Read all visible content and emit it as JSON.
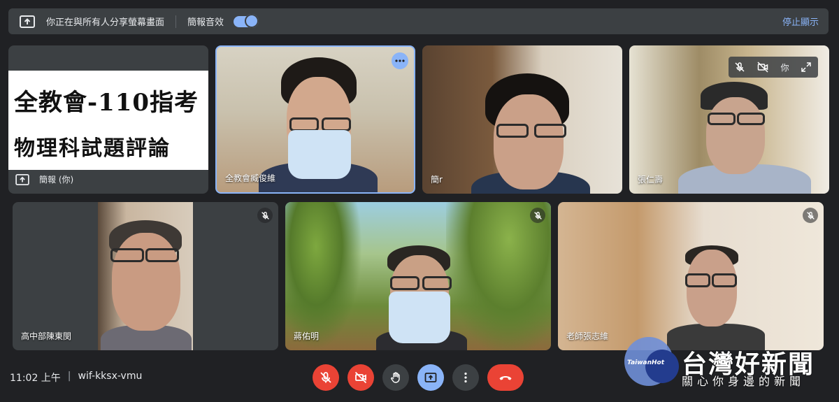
{
  "banner": {
    "message": "你正在與所有人分享螢幕畫面",
    "audio_label": "簡報音效",
    "audio_enabled": true,
    "stop_label": "停止顯示"
  },
  "presentation": {
    "slide_line1": "全教會-110指考",
    "slide_line2": "物理科試題評論",
    "label": "簡報 (你)"
  },
  "participants": [
    {
      "name": "全教會臧俊維",
      "muted": false,
      "speaking": true
    },
    {
      "name": "簡r",
      "muted": false
    },
    {
      "name": "張仁壽",
      "muted": true,
      "self": true,
      "self_label": "你"
    },
    {
      "name": "高中部陳東閔",
      "muted": true
    },
    {
      "name": "蔣佑明",
      "muted": true
    },
    {
      "name": "老師張志維",
      "muted": true
    }
  ],
  "footer": {
    "time": "11:02 上午",
    "meeting_code": "wif-kksx-vmu"
  },
  "watermark": {
    "logo_text": "TaiwanHot",
    "title": "台灣好新聞",
    "subtitle": "關心你身邊的新聞"
  },
  "colors": {
    "accent": "#8ab4f8",
    "danger": "#ea4335",
    "surface": "#3c4043",
    "background": "#202124"
  }
}
